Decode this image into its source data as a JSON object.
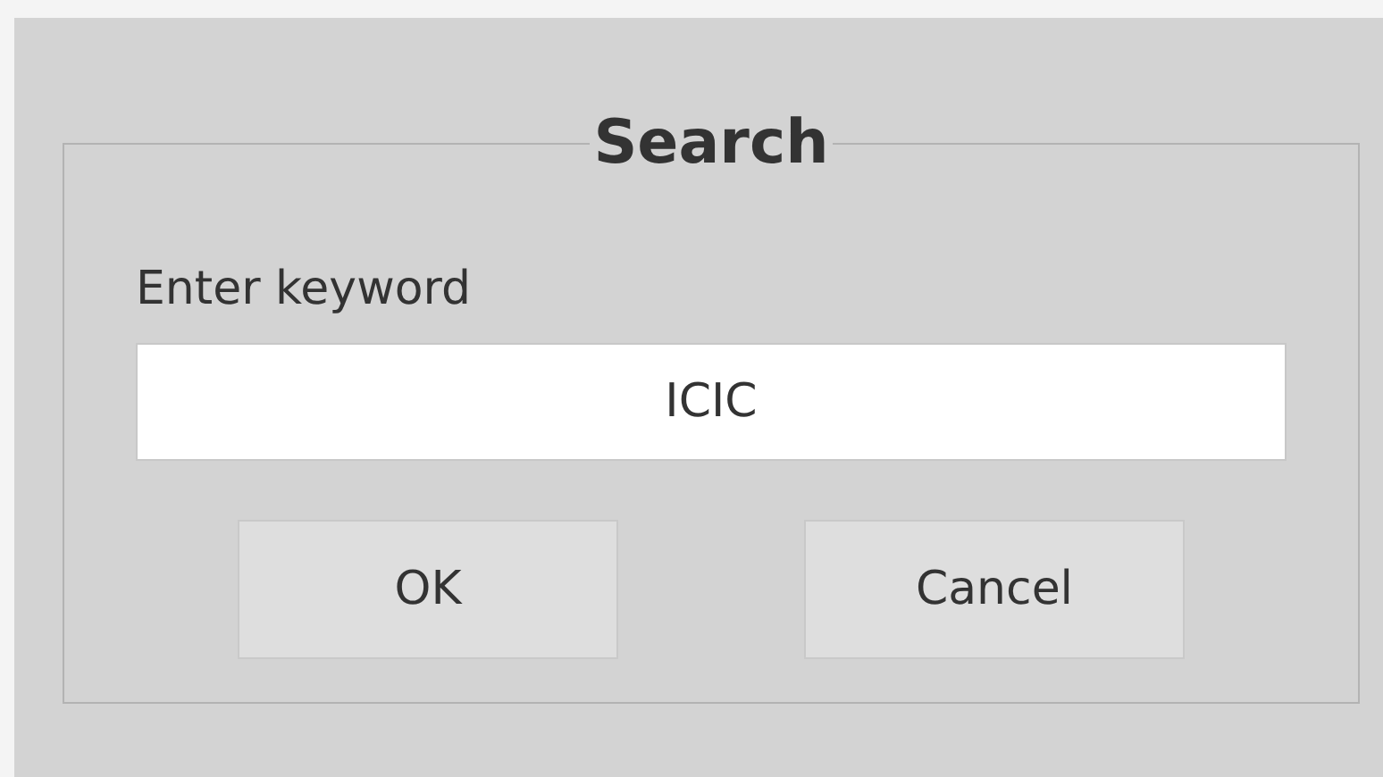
{
  "dialog": {
    "title": "Search",
    "label": "Enter keyword",
    "field": {
      "value": "ICIC"
    },
    "buttons": [
      "OK",
      "Cancel"
    ]
  }
}
